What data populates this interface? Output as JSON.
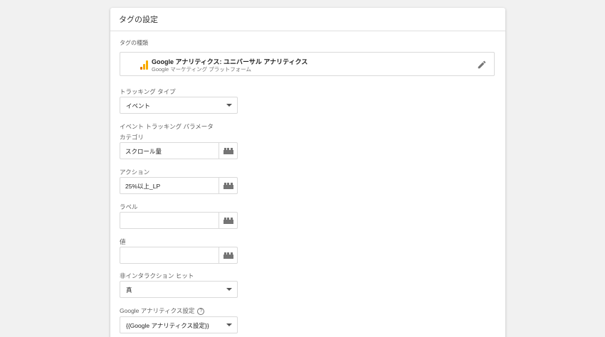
{
  "card": {
    "title": "タグの設定"
  },
  "tag_type": {
    "section_label": "タグの種類",
    "name": "Google アナリティクス: ユニバーサル アナリティクス",
    "provider": "Google マーケティング プラットフォーム",
    "icon": "analytics-icon",
    "edit_icon": "pencil-icon"
  },
  "tracking_type": {
    "label": "トラッキング タイプ",
    "value": "イベント"
  },
  "event_params": {
    "section_label": "イベント トラッキング パラメータ",
    "category": {
      "label": "カテゴリ",
      "value": "スクロール量"
    },
    "action": {
      "label": "アクション",
      "value": "25%以上_LP"
    },
    "label": {
      "label": "ラベル",
      "value": ""
    },
    "value": {
      "label": "値",
      "value": ""
    }
  },
  "non_interaction": {
    "label": "非インタラクション ヒット",
    "value": "真"
  },
  "ga_settings": {
    "label": "Google アナリティクス設定",
    "help": "?",
    "value": "{{Google アナリティクス設定}}"
  },
  "colors": {
    "accent_orange": "#f9ab00",
    "accent_dark_orange": "#e37400"
  }
}
